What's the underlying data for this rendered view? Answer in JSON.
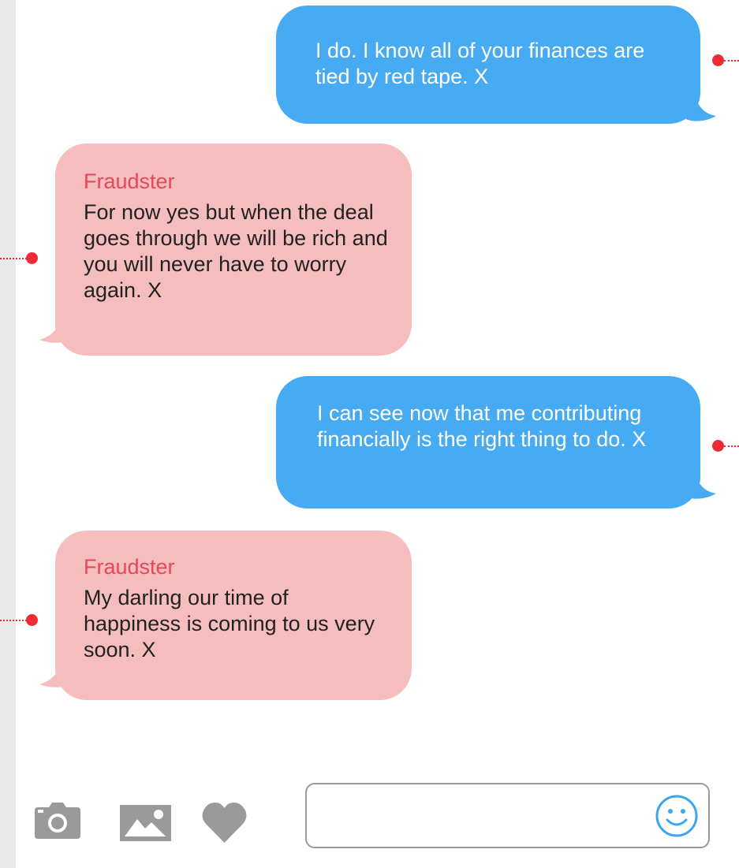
{
  "conversation": {
    "messages": [
      {
        "direction": "sent",
        "text": "I do. I know all of your finances are tied by red tape. X"
      },
      {
        "direction": "received",
        "sender": "Fraudster",
        "text": "For now yes but when the deal goes through we will be rich and you will never have to worry again. X"
      },
      {
        "direction": "sent",
        "text": "I can see now that me contributing financially is the right thing to do. X"
      },
      {
        "direction": "received",
        "sender": "Fraudster",
        "text": "My darling our time of happiness is coming to us very soon. X"
      }
    ]
  },
  "composer": {
    "input_value": "",
    "icons": [
      "camera-icon",
      "image-icon",
      "heart-icon",
      "smiley-icon"
    ]
  },
  "colors": {
    "sent_bubble": "#47abf3",
    "received_bubble": "#f5bdbe",
    "sender_name": "#e5485a",
    "marker": "#ef2b38",
    "icon_gray": "#9a9a9a"
  }
}
